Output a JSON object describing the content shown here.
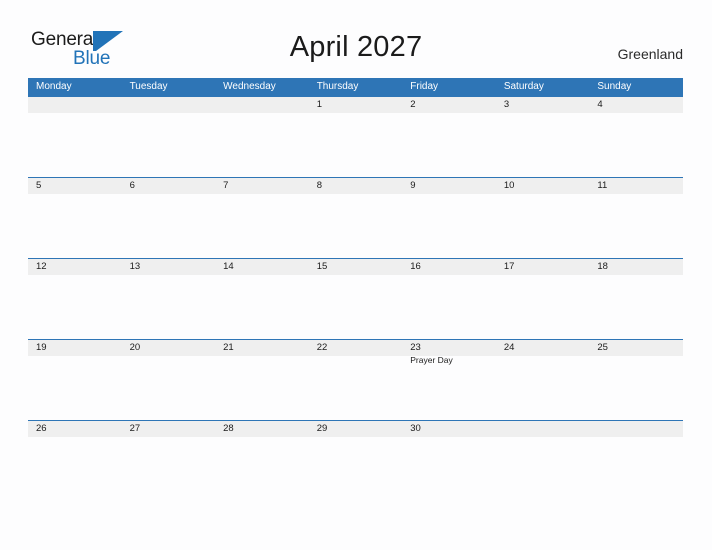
{
  "brand": {
    "logo_text_1": "General",
    "logo_text_2": "Blue",
    "logo_icon": "blue-flag-icon",
    "accent_color": "#2e75b6",
    "dark_text_color": "#1b1b1b"
  },
  "header": {
    "title": "April 2027",
    "country": "Greenland"
  },
  "calendar": {
    "header_bg": "#2e75b6",
    "band_bg": "#efefef",
    "weekdays": [
      "Monday",
      "Tuesday",
      "Wednesday",
      "Thursday",
      "Friday",
      "Saturday",
      "Sunday"
    ],
    "weeks": [
      [
        {
          "day": "",
          "event": ""
        },
        {
          "day": "",
          "event": ""
        },
        {
          "day": "",
          "event": ""
        },
        {
          "day": "1",
          "event": ""
        },
        {
          "day": "2",
          "event": ""
        },
        {
          "day": "3",
          "event": ""
        },
        {
          "day": "4",
          "event": ""
        }
      ],
      [
        {
          "day": "5",
          "event": ""
        },
        {
          "day": "6",
          "event": ""
        },
        {
          "day": "7",
          "event": ""
        },
        {
          "day": "8",
          "event": ""
        },
        {
          "day": "9",
          "event": ""
        },
        {
          "day": "10",
          "event": ""
        },
        {
          "day": "11",
          "event": ""
        }
      ],
      [
        {
          "day": "12",
          "event": ""
        },
        {
          "day": "13",
          "event": ""
        },
        {
          "day": "14",
          "event": ""
        },
        {
          "day": "15",
          "event": ""
        },
        {
          "day": "16",
          "event": ""
        },
        {
          "day": "17",
          "event": ""
        },
        {
          "day": "18",
          "event": ""
        }
      ],
      [
        {
          "day": "19",
          "event": ""
        },
        {
          "day": "20",
          "event": ""
        },
        {
          "day": "21",
          "event": ""
        },
        {
          "day": "22",
          "event": ""
        },
        {
          "day": "23",
          "event": "Prayer Day"
        },
        {
          "day": "24",
          "event": ""
        },
        {
          "day": "25",
          "event": ""
        }
      ],
      [
        {
          "day": "26",
          "event": ""
        },
        {
          "day": "27",
          "event": ""
        },
        {
          "day": "28",
          "event": ""
        },
        {
          "day": "29",
          "event": ""
        },
        {
          "day": "30",
          "event": ""
        },
        {
          "day": "",
          "event": ""
        },
        {
          "day": "",
          "event": ""
        }
      ]
    ]
  }
}
